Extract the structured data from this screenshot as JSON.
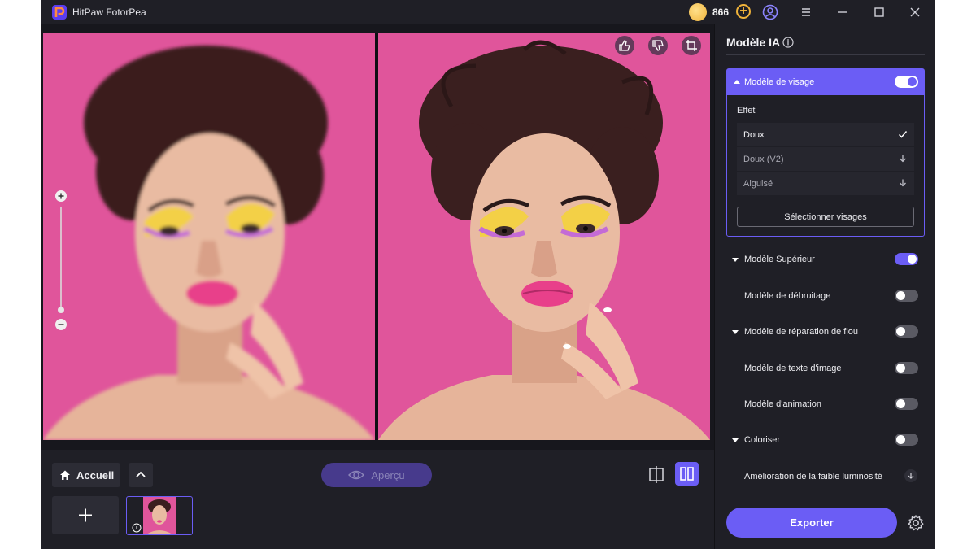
{
  "app": {
    "title": "HitPaw FotorPea",
    "coins": "866"
  },
  "colors": {
    "accent": "#6b5df5",
    "background": "#1f1f26",
    "photo_bg": "#e0559b"
  },
  "bottom": {
    "home_label": "Accueil",
    "preview_label": "Aperçu"
  },
  "panel": {
    "title": "Modèle IA",
    "face_model": {
      "label": "Modèle de visage",
      "enabled": true,
      "effect_title": "Effet",
      "options": [
        {
          "label": "Doux",
          "state": "selected",
          "icon": "check-icon"
        },
        {
          "label": "Doux (V2)",
          "state": "download",
          "icon": "download-icon"
        },
        {
          "label": "Aiguisé",
          "state": "download",
          "icon": "download-icon"
        }
      ],
      "select_faces_label": "Sélectionner visages"
    },
    "models": [
      {
        "label": "Modèle Supérieur",
        "expandable": true,
        "enabled": true
      },
      {
        "label": "Modèle de débruitage",
        "expandable": false,
        "enabled": false
      },
      {
        "label": "Modèle de réparation de flou",
        "expandable": true,
        "enabled": false
      },
      {
        "label": "Modèle de texte d'image",
        "expandable": false,
        "enabled": false
      },
      {
        "label": "Modèle d'animation",
        "expandable": false,
        "enabled": false
      },
      {
        "label": "Coloriser",
        "expandable": true,
        "enabled": false
      },
      {
        "label": "Amélioration de la faible luminosité",
        "expandable": false,
        "download": true
      }
    ],
    "export_label": "Exporter"
  }
}
